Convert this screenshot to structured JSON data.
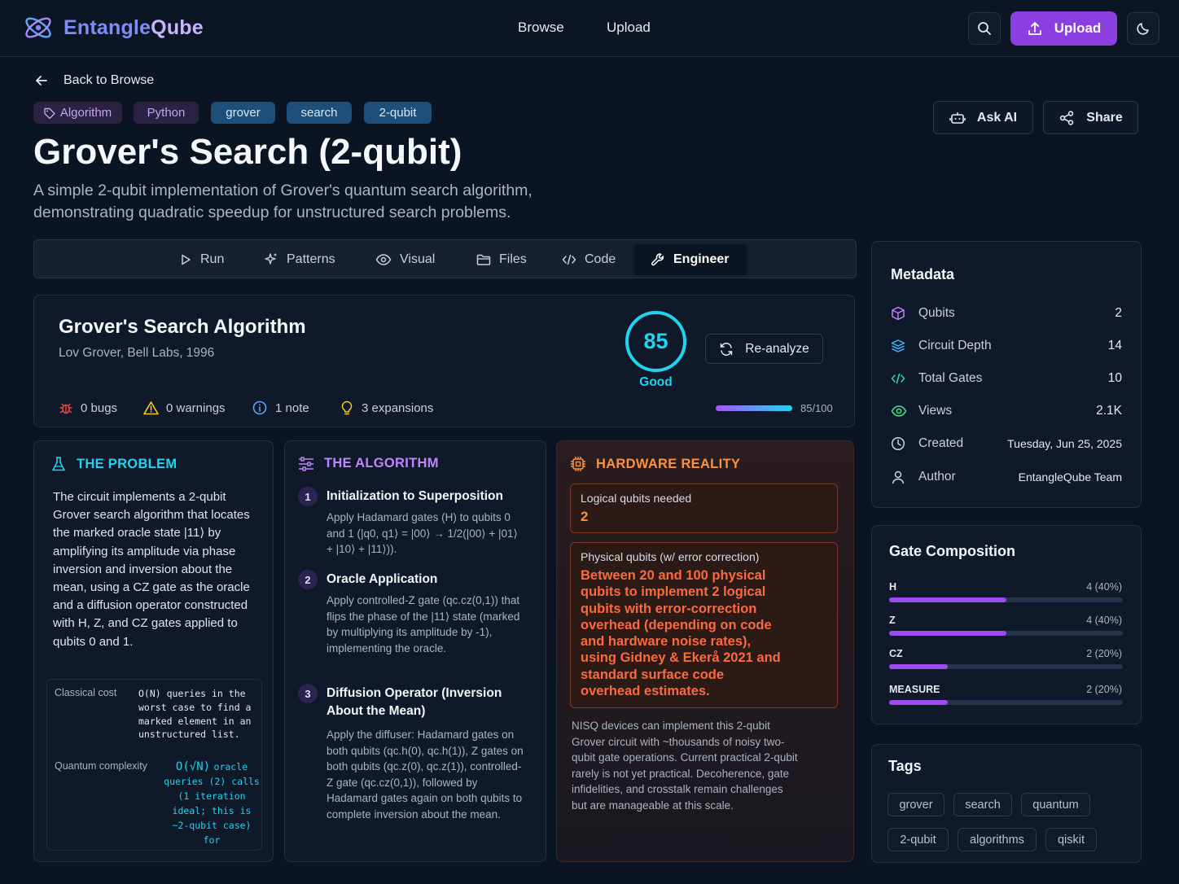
{
  "header": {
    "brand_part1": "Entangle",
    "brand_part2": "Qube",
    "nav": [
      "Browse",
      "Upload"
    ],
    "upload_label": "Upload"
  },
  "back_label": "Back to Browse",
  "tags_top": [
    {
      "label": "Algorithm",
      "style": "purple",
      "icon": "tag-icon"
    },
    {
      "label": "Python",
      "style": "purple"
    },
    {
      "label": "grover",
      "style": "blue"
    },
    {
      "label": "search",
      "style": "blue"
    },
    {
      "label": "2-qubit",
      "style": "blue"
    }
  ],
  "actions": {
    "ask_ai": "Ask AI",
    "share": "Share"
  },
  "title": "Grover's Search (2-qubit)",
  "subtitle": "A simple 2-qubit implementation of Grover's quantum search algorithm, demonstrating quadratic speedup for unstructured search problems.",
  "tabs": [
    {
      "label": "Run",
      "icon": "play-icon"
    },
    {
      "label": "Patterns",
      "icon": "sparkle-icon"
    },
    {
      "label": "Visual",
      "icon": "eye-icon"
    },
    {
      "label": "Files",
      "icon": "folder-icon"
    },
    {
      "label": "Code",
      "icon": "code-icon"
    },
    {
      "label": "Engineer",
      "icon": "wrench-icon",
      "active": true
    }
  ],
  "analysis": {
    "title": "Grover's Search Algorithm",
    "byline": "Lov Grover, Bell Labs, 1996",
    "score": "85",
    "score_label": "Good",
    "reanalyze": "Re-analyze",
    "bugs": "0 bugs",
    "warnings": "0 warnings",
    "notes": "1 note",
    "expansions": "3 expansions",
    "progress": 0.85,
    "progress_label": "85/100"
  },
  "problem": {
    "heading": "THE PROBLEM",
    "text": "The circuit implements a 2-qubit Grover search algorithm that locates the marked oracle state |11⟩ by amplifying its amplitude via phase inversion and inversion about the mean, using a CZ gate as the oracle and a diffusion operator constructed with H, Z, and CZ gates applied to qubits 0 and 1.",
    "classical_label": "Classical cost",
    "classical_value": "O(N) queries in the worst case to find a marked element in an unstructured list.",
    "quantum_label": "Quantum complexity",
    "quantum_value_head": "O(√N)",
    "quantum_value": "oracle queries (2) calls (1 iteration ideal; this is ~2-qubit case) for"
  },
  "algorithm": {
    "heading": "THE ALGORITHM",
    "steps": [
      {
        "num": "1",
        "title": "Initialization to Superposition",
        "desc": "Apply Hadamard gates (H) to qubits 0 and 1 (|q0, q1⟩ = |00⟩ → 1/2(|00⟩ + |01⟩ + |10⟩ + |11⟩))."
      },
      {
        "num": "2",
        "title": "Oracle Application",
        "desc": "Apply controlled-Z gate (qc.cz(0,1)) that flips the phase of the |11⟩ state (marked by multiplying its amplitude by -1), implementing the oracle."
      },
      {
        "num": "3",
        "title": "Diffusion Operator (Inversion About the Mean)",
        "desc": "Apply the diffuser: Hadamard gates on both qubits (qc.h(0), qc.h(1)), Z gates on both qubits (qc.z(0), qc.z(1)), controlled-Z gate (qc.cz(0,1)), followed by Hadamard gates again on both qubits to complete inversion about the mean."
      }
    ]
  },
  "hardware": {
    "heading": "HARDWARE REALITY",
    "logical_label": "Logical qubits needed",
    "logical_value": "2",
    "physical_label": "Physical qubits (w/ error correction)",
    "physical_value": "Between 20 and 100 physical qubits to implement 2 logical qubits with error-correction overhead (depending on code and hardware noise rates), using Gidney & Ekerå 2021 and standard surface code overhead estimates.",
    "note": "NISQ devices can implement this 2-qubit Grover circuit with ~thousands of noisy two-qubit gate operations. Current practical 2-qubit rarely is not yet practical. Decoherence, gate infidelities, and crosstalk remain challenges but are manageable at this scale."
  },
  "metadata": {
    "heading": "Metadata",
    "rows": [
      {
        "label": "Qubits",
        "value": "2",
        "icon": "cube-icon",
        "color": "#c084fc"
      },
      {
        "label": "Circuit Depth",
        "value": "14",
        "icon": "layers-icon",
        "color": "#38bdf8"
      },
      {
        "label": "Total Gates",
        "value": "10",
        "icon": "code-icon",
        "color": "#34d399"
      },
      {
        "label": "Views",
        "value": "2.1K",
        "icon": "eye-icon",
        "color": "#4ade80"
      },
      {
        "label": "Created",
        "value": "Tuesday, Jun 25, 2025",
        "icon": "clock-icon",
        "color": "#cbd5e1"
      },
      {
        "label": "Author",
        "value": "EntangleQube Team",
        "icon": "user-icon",
        "color": "#cbd5e1"
      }
    ]
  },
  "gates": {
    "heading": "Gate Composition",
    "items": [
      {
        "label": "H",
        "value": "4 (40%)",
        "fraction": 0.4
      },
      {
        "label": "Z",
        "value": "4 (40%)",
        "fraction": 0.4
      },
      {
        "label": "CZ",
        "value": "2 (20%)",
        "fraction": 0.2
      },
      {
        "label": "MEASURE",
        "value": "2 (20%)",
        "fraction": 0.2
      }
    ]
  },
  "tags_panel": {
    "heading": "Tags",
    "items": [
      "grover",
      "search",
      "quantum",
      "2-qubit",
      "algorithms",
      "qiskit"
    ]
  },
  "colors": {
    "accent": "#8b3fe0",
    "cyan": "#22d3ee",
    "orange": "#fb923c",
    "violet": "#c084fc"
  }
}
